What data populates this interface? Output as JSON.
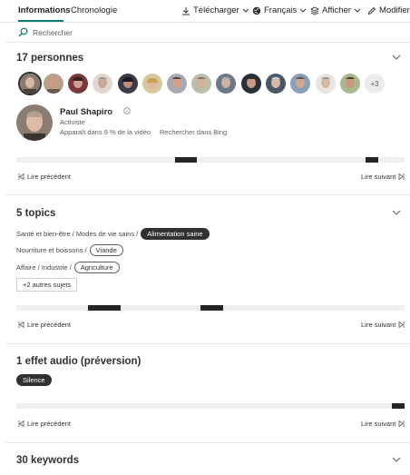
{
  "tabs": [
    "Informations",
    "Chronologie"
  ],
  "toolbar": {
    "download": "Télécharger",
    "language": "Français",
    "view": "Afficher",
    "edit": "Modifier"
  },
  "search": {
    "label": "Rechercher"
  },
  "people": {
    "title": "17 personnes",
    "more": "+3",
    "selected": {
      "name": "Paul Shapiro",
      "role": "Activiste",
      "appears": "Apparaît dans 9 % de la vidéo",
      "bing": "Rechercher dans Bing"
    },
    "prev": "Lire précédent",
    "next": "Lire suivant"
  },
  "topics": {
    "title": "5 topics",
    "rows": [
      {
        "path": "Santé et bien-être / Modes de vie sains /",
        "chip": "Alimentation saine"
      },
      {
        "path": "Nourriture et boissons /",
        "chip": "Viande"
      },
      {
        "path": "Affaire / Industrie /",
        "chip": "Agriculture"
      }
    ],
    "more": "+2 autres sujets",
    "prev": "Lire précédent",
    "next": "Lire suivant"
  },
  "audio": {
    "title": "1 effet audio (préversion)",
    "chip": "Silence",
    "prev": "Lire précédent",
    "next": "Lire suivant"
  },
  "keywords": {
    "title": "30 keywords"
  },
  "colors": {
    "accent": "#0a7c70",
    "dark": "#252423",
    "track": "#efefef"
  }
}
